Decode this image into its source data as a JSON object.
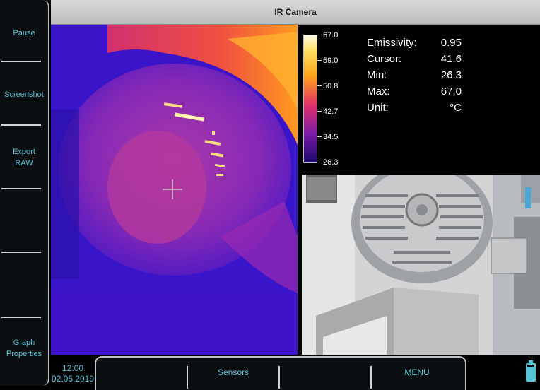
{
  "title": "IR Camera",
  "softkeys": {
    "pause": "Pause",
    "screenshot": "Screenshot",
    "export_raw_line1": "Export",
    "export_raw_line2": "RAW",
    "graph_line1": "Graph",
    "graph_line2": "Properties"
  },
  "scale": {
    "ticks": [
      "67.0",
      "59.0",
      "50.8",
      "42.7",
      "34.5",
      "26.3"
    ]
  },
  "readout": {
    "emissivity_label": "Emissivity:",
    "emissivity_value": "0.95",
    "cursor_label": "Cursor:",
    "cursor_value": "41.6",
    "min_label": "Min:",
    "min_value": "26.3",
    "max_label": "Max:",
    "max_value": "67.0",
    "unit_label": "Unit:",
    "unit_value": "°C"
  },
  "status": {
    "time": "12:00",
    "date": "02.05.2019"
  },
  "bottomkeys": {
    "sensors": "Sensors",
    "menu": "MENU"
  },
  "icons": {
    "battery": "battery-icon",
    "crosshair": "crosshair-icon"
  }
}
